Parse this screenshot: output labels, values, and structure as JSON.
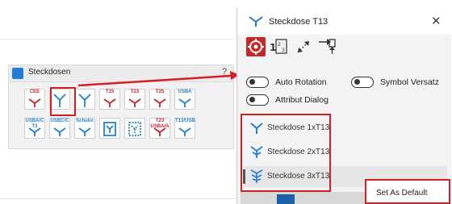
{
  "toolbar": {
    "title": "Steckdosen",
    "close_label": "?",
    "row1": [
      {
        "label": "CEE",
        "label_color": "#d11f26",
        "icon_color": "#d11f26",
        "icon": "socket-cee-icon"
      },
      {
        "label": "",
        "label_color": "#1f7fd6",
        "icon_color": "#1f7fd6",
        "icon": "socket-icon"
      },
      {
        "label": "",
        "label_color": "#1f7fd6",
        "icon_color": "#1f7fd6",
        "icon": "socket-multi-icon"
      },
      {
        "label": "T15",
        "label_color": "#d11f26",
        "icon_color": "#d11f26",
        "icon": "socket-t15-icon"
      },
      {
        "label": "T23",
        "label_color": "#d11f26",
        "icon_color": "#d11f26",
        "icon": "socket-t23-icon"
      },
      {
        "label": "T25",
        "label_color": "#d11f26",
        "icon_color": "#d11f26",
        "icon": "socket-t25-icon"
      },
      {
        "label": "USBA",
        "label_color": "#1f7fd6",
        "icon_color": "#1f7fd6",
        "icon": "socket-usba-icon"
      }
    ],
    "row2": [
      {
        "label": "USBA/C T3",
        "label_color": "#1f7fd6",
        "icon_color": "#1f7fd6",
        "icon": "socket-usbac-t3-icon"
      },
      {
        "label": "USBC/C",
        "label_color": "#1f7fd6",
        "icon_color": "#1f7fd6",
        "icon": "socket-usbcc-icon"
      },
      {
        "label": "Schuko",
        "label_color": "#1f7fd6",
        "icon_color": "#1f7fd6",
        "icon": "socket-schuko-icon"
      },
      {
        "label": "",
        "label_color": "#1f7fd6",
        "icon_color": "#1f7fd6",
        "icon": "socket-box-icon"
      },
      {
        "label": "",
        "label_color": "#1f7fd6",
        "icon_color": "#1f7fd6",
        "icon": "socket-dashed-box-icon"
      },
      {
        "label": "T23 USBA/A",
        "label_color": "#d11f26",
        "icon_color": "#d11f26",
        "icon": "socket-t23-usba-icon"
      },
      {
        "label": "T13/USB",
        "label_color": "#1f7fd6",
        "icon_color": "#1f7fd6",
        "icon": "socket-t13-usb-icon"
      }
    ]
  },
  "dialog": {
    "title": "Steckdose T13",
    "close_label": "✕",
    "tools": [
      "target-icon",
      "numbering-icon",
      "resize-icon",
      "insert-icon"
    ],
    "toggles": {
      "auto_rotation": "Auto Rotation",
      "symbol_versatz": "Symbol Versatz",
      "attribut_dialog": "Attribut Dialog"
    },
    "items": [
      "Steckdose 1xT13",
      "Steckdose 2xT13",
      "Steckdose 3xT13"
    ],
    "selected_index": 2
  },
  "context_menu": {
    "set_default": "Set As Default"
  },
  "colors": {
    "accent_blue": "#1f7fd6",
    "accent_red": "#d11f26",
    "arrow_red": "#d11f26"
  }
}
